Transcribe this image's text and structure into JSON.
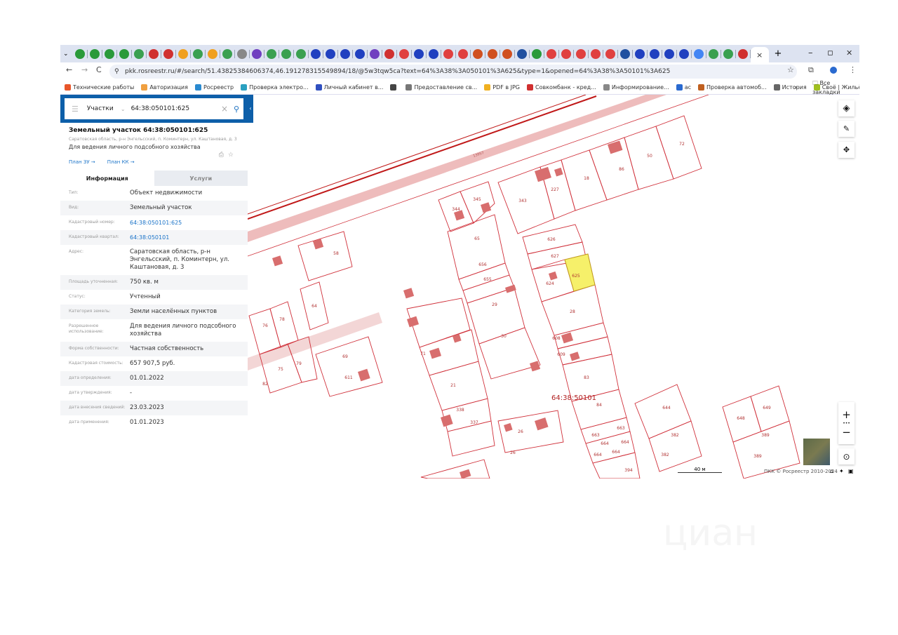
{
  "browser": {
    "tabs": [
      "green",
      "green",
      "green",
      "green",
      "check",
      "flag",
      "flag",
      "dots",
      "check",
      "dots",
      "check",
      "gray",
      "ring",
      "check",
      "check",
      "check",
      "blue",
      "blue",
      "blue",
      "blue",
      "ring",
      "flag",
      "red",
      "blue",
      "blue",
      "red",
      "red",
      "stripe",
      "stripe",
      "stripe",
      "globe",
      "green",
      "red",
      "red",
      "red",
      "red",
      "red",
      "globe",
      "blue",
      "blue",
      "blue",
      "blue",
      "google",
      "check",
      "check",
      "flag"
    ],
    "active_tab_close": "×",
    "new_tab": "+",
    "minimize": "–",
    "restore": "▫",
    "close": "✕",
    "url": "pkk.rosreestr.ru/#/search/51.43825384606374,46.191278315549894/18/@5w3tqw5ca?text=64%3A38%3A050101%3A625&type=1&opened=64%3A38%3A50101%3A625",
    "bookmarks": [
      {
        "label": "Технические работы",
        "color": "#e8562b"
      },
      {
        "label": "Авторизация",
        "color": "#f0a040"
      },
      {
        "label": "Росреестр",
        "color": "#2a8ad0"
      },
      {
        "label": "Проверка электро...",
        "color": "#2aa0c0"
      },
      {
        "label": "Личный кабинет в...",
        "color": "#3050c0"
      },
      {
        "label": "",
        "color": "#444"
      },
      {
        "label": "Предоставление св...",
        "color": "#777"
      },
      {
        "label": "PDF в JPG",
        "color": "#f0b020"
      },
      {
        "label": "Совкомбанк - кред...",
        "color": "#d03030"
      },
      {
        "label": "Информирование...",
        "color": "#888"
      },
      {
        "label": "ас",
        "color": "#2a6ad0"
      },
      {
        "label": "Проверка автомоб...",
        "color": "#c06020"
      },
      {
        "label": "История",
        "color": "#666"
      },
      {
        "label": "Своё | Жильё - Лич...",
        "color": "#a0c020"
      }
    ],
    "more": "»",
    "all_bookmarks": "Все закладки"
  },
  "sidebar": {
    "search": {
      "mode": "Участки",
      "value": "64:38:050101:625",
      "clear": "×"
    },
    "card": {
      "title": "Земельный участок 64:38:050101:625",
      "address_short": "Саратовская область, р-н Энгельсский, п. Коминтерн, ул. Каштановая, д. 3",
      "purpose": "Для ведения личного подсобного хозяйства",
      "plan_zu": "План ЗУ →",
      "plan_kk": "План КК →"
    },
    "tabs": [
      "Информация",
      "Услуги"
    ],
    "rows": [
      {
        "label": "Тип:",
        "value": "Объект недвижимости"
      },
      {
        "label": "Вид:",
        "value": "Земельный участок"
      },
      {
        "label": "Кадастровый номер:",
        "value": "64:38:050101:625",
        "link": true
      },
      {
        "label": "Кадастровый квартал:",
        "value": "64:38:050101",
        "link": true
      },
      {
        "label": "Адрес:",
        "value": "Саратовская область, р-н Энгельсский, п. Коминтерн, ул. Каштановая, д. 3"
      },
      {
        "label": "Площадь уточненная:",
        "value": "750 кв. м"
      },
      {
        "label": "Статус:",
        "value": "Учтенный"
      },
      {
        "label": "Категория земель:",
        "value": "Земли населённых пунктов"
      },
      {
        "label": "Разрешенное использование:",
        "value": "Для ведения личного подсобного хозяйства"
      },
      {
        "label": "Форма собственности:",
        "value": "Частная собственность"
      },
      {
        "label": "Кадастровая стоимость:",
        "value": "657 907,5 руб."
      },
      {
        "label": "дата определения:",
        "value": "01.01.2022"
      },
      {
        "label": "дата утверждения:",
        "value": "-"
      },
      {
        "label": "дата внесения сведений:",
        "value": "23.03.2023"
      },
      {
        "label": "дата применения:",
        "value": "01.01.2023"
      }
    ]
  },
  "map": {
    "parcels": [
      "626",
      "627",
      "624",
      "625",
      "28",
      "656",
      "655",
      "65",
      "29",
      "30",
      "343",
      "227",
      "18",
      "86",
      "50",
      "72",
      "344",
      "345",
      "58",
      "64",
      "76",
      "78",
      "75",
      "79",
      "82",
      "69",
      "611",
      "71",
      "21",
      "338",
      "337",
      "26",
      "26",
      "83",
      "84",
      "663",
      "663",
      "664",
      "664",
      "664",
      "664",
      "644",
      "382",
      "382",
      "648",
      "649",
      "389",
      "389",
      "394",
      "608",
      "609"
    ],
    "road_label": "13957",
    "quarter_label": "64:38:50101",
    "scale": "40 м",
    "copyright": "ПКК © Росреестр 2010-2024",
    "zoom_in": "+",
    "zoom_more": "•••",
    "zoom_out": "−",
    "selected_color": "#f6f06a",
    "line_color": "#d0303a"
  },
  "watermark": "циан"
}
